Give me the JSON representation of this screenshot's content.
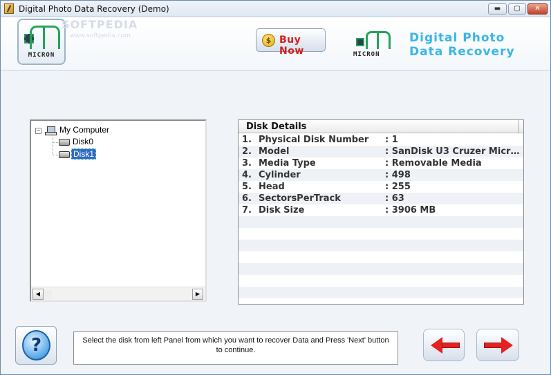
{
  "window": {
    "title": "Digital Photo Data Recovery (Demo)",
    "controls": {
      "minimize": "▬",
      "maximize": "▢",
      "close": "✕"
    }
  },
  "header": {
    "logo_text": "MICRON",
    "logo_bits": "001",
    "watermark": "SOFTPEDIA",
    "watermark_url": "www.softpedia.com",
    "buy_button": {
      "label": "Buy Now",
      "coin": "$"
    },
    "brand_line1": "Digital Photo",
    "brand_line2": "Data Recovery",
    "brand_color": "#39b6e6"
  },
  "tree": {
    "root": "My Computer",
    "expander": "−",
    "children": [
      "Disk0",
      "Disk1"
    ],
    "selected": "Disk1",
    "scroll_left": "◀",
    "scroll_right": "▶"
  },
  "details": {
    "header": "Disk Details",
    "rows": [
      {
        "num": "1.",
        "label": "Physical Disk Number",
        "value": ": 1"
      },
      {
        "num": "2.",
        "label": "Model",
        "value": ": SanDisk U3 Cruzer Micro ..."
      },
      {
        "num": "3.",
        "label": "Media Type",
        "value": ": Removable Media"
      },
      {
        "num": "4.",
        "label": "Cylinder",
        "value": ": 498"
      },
      {
        "num": "5.",
        "label": "Head",
        "value": ": 255"
      },
      {
        "num": "6.",
        "label": "SectorsPerTrack",
        "value": ": 63"
      },
      {
        "num": "7.",
        "label": "Disk Size",
        "value": ": 3906 MB"
      }
    ]
  },
  "footer": {
    "help_label": "?",
    "message": "Select the disk from left Panel from which you want to recover Data and Press 'Next' button to continue."
  },
  "colors": {
    "accent_red": "#e52020",
    "selection": "#3169c6",
    "logo_green": "#25a35a"
  }
}
